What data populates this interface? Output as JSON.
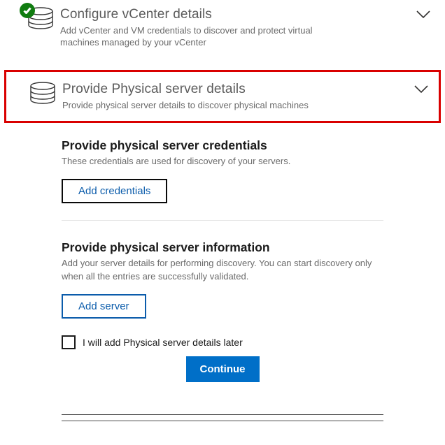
{
  "section1": {
    "title": "Configure vCenter details",
    "desc": "Add vCenter and VM credentials to discover and protect virtual machines managed by your vCenter",
    "icon": "database-icon",
    "status_icon": "check-success-icon"
  },
  "section2": {
    "title": "Provide Physical server details",
    "desc": "Provide physical server details to discover physical machines",
    "icon": "database-icon"
  },
  "step_cred": {
    "title": "Provide physical server credentials",
    "desc": "These credentials are used for discovery of your servers.",
    "button": "Add credentials"
  },
  "step_info": {
    "title": "Provide physical server information",
    "desc": "Add your server details for performing discovery. You can start discovery only when all the entries are successfully validated.",
    "button": "Add server"
  },
  "deferral_checkbox": {
    "label": "I will add Physical server details later",
    "checked": false
  },
  "primary_action": {
    "label": "Continue"
  },
  "colors": {
    "accent": "#006fc8",
    "highlight": "#d90000",
    "success": "#107c10"
  }
}
